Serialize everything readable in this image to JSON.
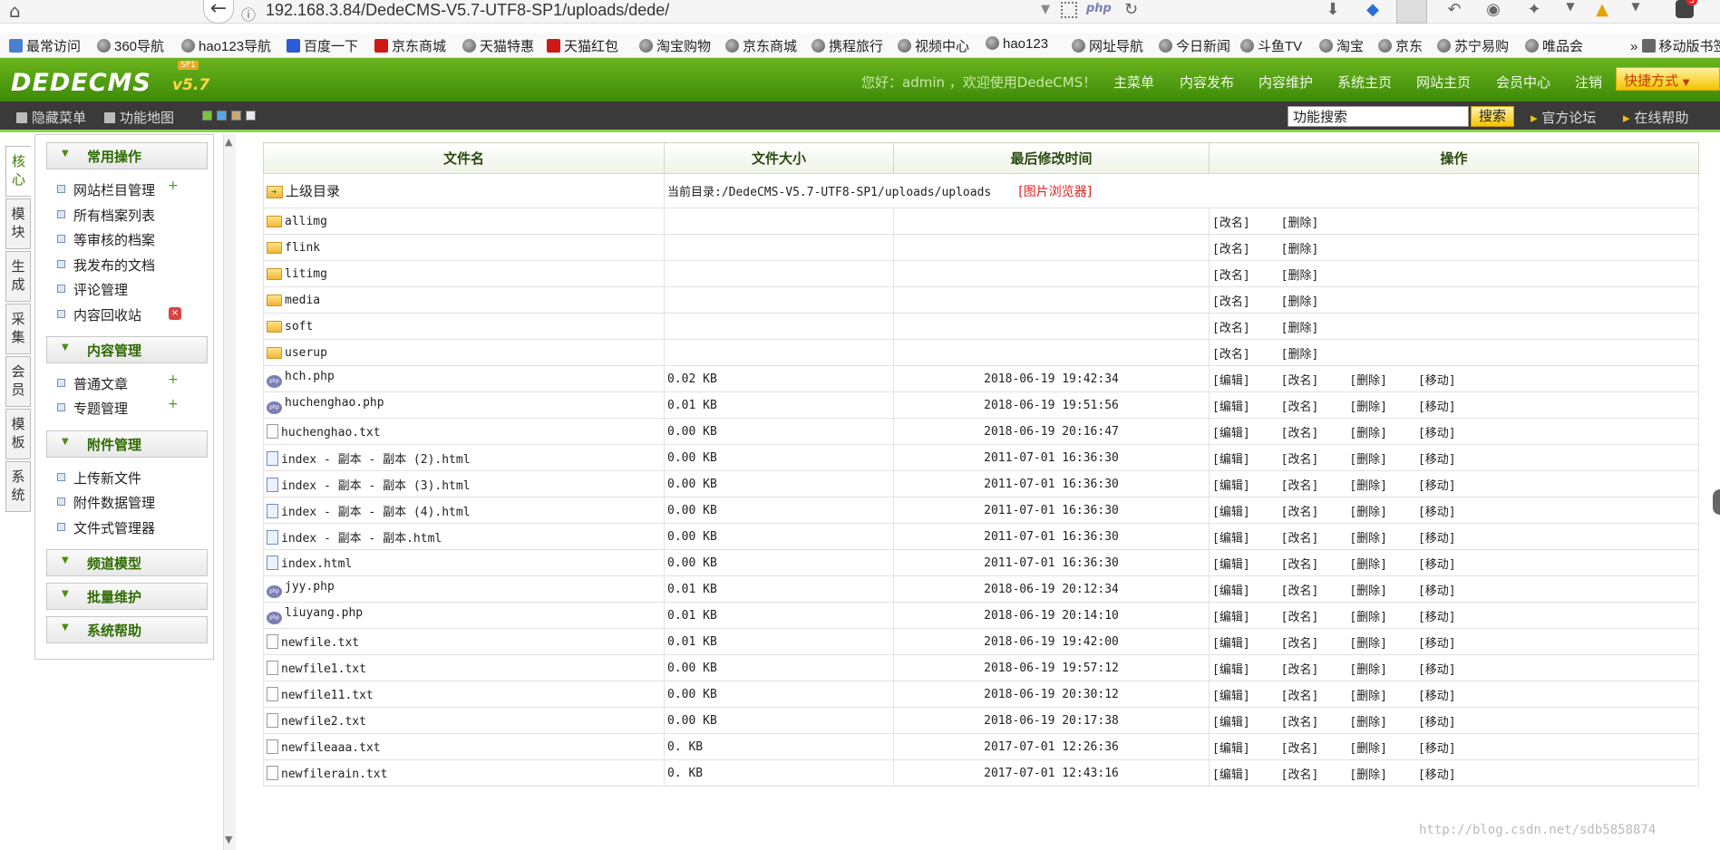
{
  "browser": {
    "url": "192.168.3.84/DedeCMS-V5.7-UTF8-SP1/uploads/dede/",
    "php_badge": "php"
  },
  "bookmarks": [
    "最常访问",
    "360导航",
    "hao123导航",
    "百度一下",
    "京东商城",
    "天猫特惠",
    "天猫红包",
    "淘宝购物",
    "京东商城",
    "携程旅行",
    "视频中心",
    "hao123",
    "网址导航",
    "今日新闻",
    "斗鱼TV",
    "淘宝",
    "京东",
    "苏宁易购",
    "唯品会",
    "移动版书签"
  ],
  "header": {
    "logo": "DEDECMS",
    "version": "v5.7",
    "sp": "SP1",
    "welcome": "您好：admin ，欢迎使用DedeCMS！",
    "nav": [
      "主菜单",
      "内容发布",
      "内容维护",
      "系统主页",
      "网站主页",
      "会员中心",
      "注销"
    ],
    "quick": "快捷方式"
  },
  "toolbar": {
    "hide_menu": "隐藏菜单",
    "site_map": "功能地图",
    "search_value": "功能搜索",
    "search_btn": "搜索",
    "forum": "官方论坛",
    "help": "在线帮助"
  },
  "vtabs": [
    "核心",
    "模块",
    "生成",
    "采集",
    "会员",
    "模板",
    "系统"
  ],
  "menu": {
    "groups": [
      "常用操作",
      "内容管理",
      "附件管理",
      "频道模型",
      "批量维护",
      "系统帮助"
    ],
    "common": [
      "网站栏目管理",
      "所有档案列表",
      "等审核的档案",
      "我发布的文档",
      "评论管理",
      "内容回收站"
    ],
    "content": [
      "普通文章",
      "专题管理"
    ],
    "attach": [
      "上传新文件",
      "附件数据管理",
      "文件式管理器"
    ],
    "add_icon": "+",
    "del_icon": "×"
  },
  "table": {
    "headers": [
      "文件名",
      "文件大小",
      "最后修改时间",
      "操作"
    ],
    "parent_label": "上级目录",
    "current_dir": "当前目录:/DedeCMS-V5.7-UTF8-SP1/uploads/uploads",
    "image_browser": "[图片浏览器]",
    "actions": {
      "edit": "[编辑]",
      "rename": "[改名]",
      "delete": "[删除]",
      "move": "[移动]"
    },
    "folders": [
      "allimg",
      "flink",
      "litimg",
      "media",
      "soft",
      "userup"
    ],
    "files": [
      {
        "name": "hch.php",
        "size": "0.02 KB",
        "time": "2018-06-19 19:42:34",
        "type": "php"
      },
      {
        "name": "huchenghao.php",
        "size": "0.01 KB",
        "time": "2018-06-19 19:51:56",
        "type": "php"
      },
      {
        "name": "huchenghao.txt",
        "size": "0.00 KB",
        "time": "2018-06-19 20:16:47",
        "type": "txt"
      },
      {
        "name": "index - 副本 - 副本 (2).html",
        "size": "0.00 KB",
        "time": "2011-07-01 16:36:30",
        "type": "html"
      },
      {
        "name": "index - 副本 - 副本 (3).html",
        "size": "0.00 KB",
        "time": "2011-07-01 16:36:30",
        "type": "html"
      },
      {
        "name": "index - 副本 - 副本 (4).html",
        "size": "0.00 KB",
        "time": "2011-07-01 16:36:30",
        "type": "html"
      },
      {
        "name": "index - 副本 - 副本.html",
        "size": "0.00 KB",
        "time": "2011-07-01 16:36:30",
        "type": "html"
      },
      {
        "name": "index.html",
        "size": "0.00 KB",
        "time": "2011-07-01 16:36:30",
        "type": "html"
      },
      {
        "name": "jyy.php",
        "size": "0.01 KB",
        "time": "2018-06-19 20:12:34",
        "type": "php"
      },
      {
        "name": "liuyang.php",
        "size": "0.01 KB",
        "time": "2018-06-19 20:14:10",
        "type": "php"
      },
      {
        "name": "newfile.txt",
        "size": "0.01 KB",
        "time": "2018-06-19 19:42:00",
        "type": "txt"
      },
      {
        "name": "newfile1.txt",
        "size": "0.00 KB",
        "time": "2018-06-19 19:57:12",
        "type": "txt"
      },
      {
        "name": "newfile11.txt",
        "size": "0.00 KB",
        "time": "2018-06-19 20:30:12",
        "type": "txt"
      },
      {
        "name": "newfile2.txt",
        "size": "0.00 KB",
        "time": "2018-06-19 20:17:38",
        "type": "txt"
      },
      {
        "name": "newfileaaa.txt",
        "size": "0. KB",
        "time": "2017-07-01 12:26:36",
        "type": "txt"
      },
      {
        "name": "newfilerain.txt",
        "size": "0. KB",
        "time": "2017-07-01 12:43:16",
        "type": "txt"
      }
    ]
  },
  "watermark": "http://blog.csdn.net/sdb5858874"
}
